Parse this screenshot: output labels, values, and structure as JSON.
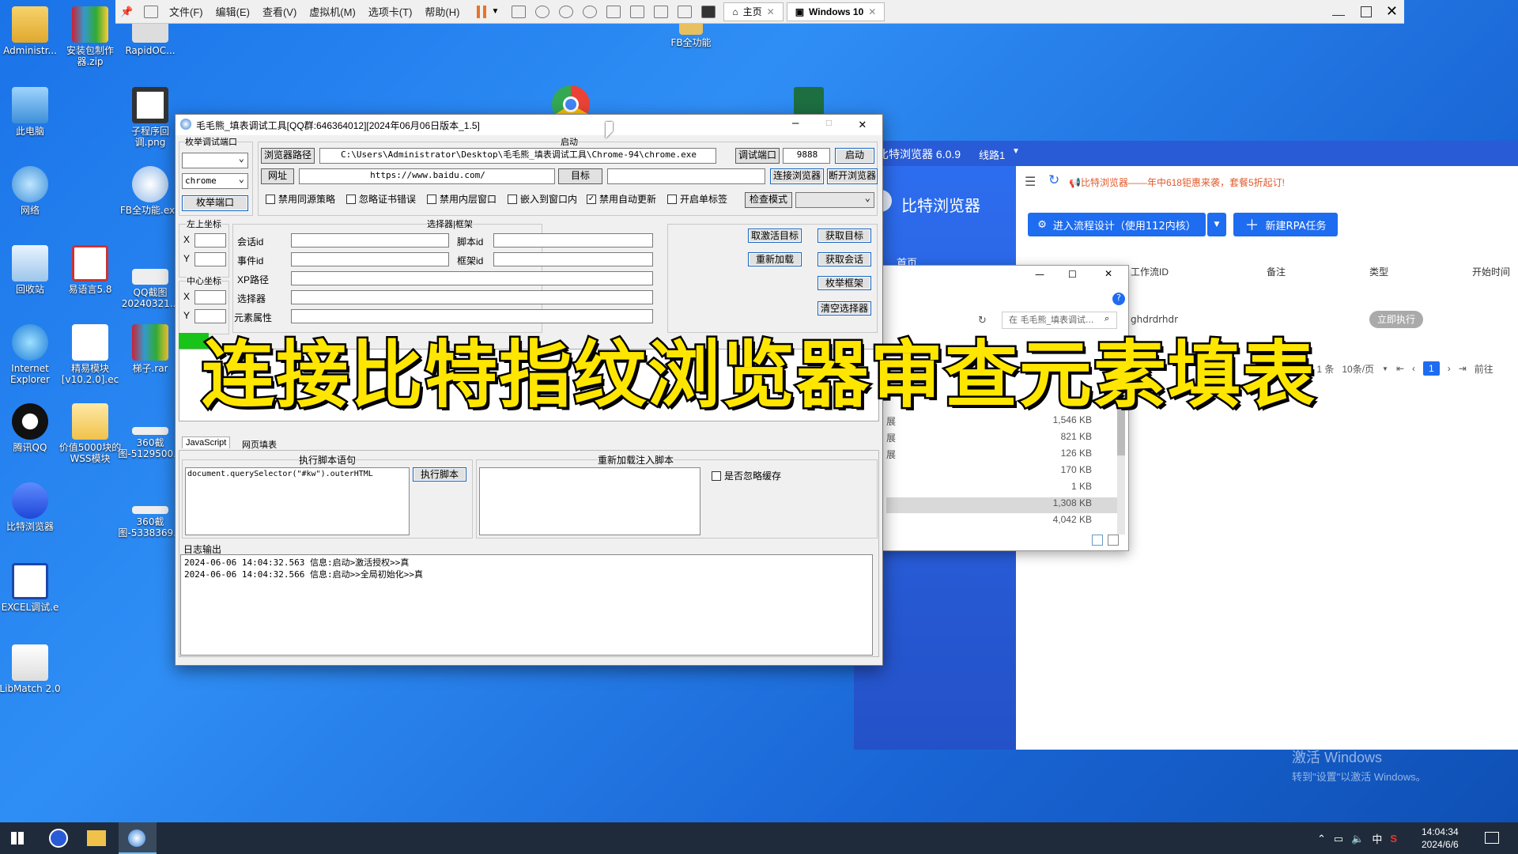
{
  "desktop": {
    "icons": [
      {
        "label": "Administr...",
        "name": "desktop-icon-admin"
      },
      {
        "label": "安装包制作器.zip",
        "name": "desktop-icon-installer-zip"
      },
      {
        "label": "RapidOC...",
        "name": "desktop-icon-rapidoc"
      },
      {
        "label": "此电脑",
        "name": "desktop-icon-this-pc"
      },
      {
        "label": "子程序回调.png",
        "name": "desktop-icon-subprogram-png"
      },
      {
        "label": "网络",
        "name": "desktop-icon-network"
      },
      {
        "label": "FB全功能.exe",
        "name": "desktop-icon-fb-exe"
      },
      {
        "label": "回收站",
        "name": "desktop-icon-recycle-bin"
      },
      {
        "label": "易语言5.8",
        "name": "desktop-icon-eyuyan"
      },
      {
        "label": "QQ截图20240321...",
        "name": "desktop-icon-qq-screenshot"
      },
      {
        "label": "Internet Explorer",
        "name": "desktop-icon-ie"
      },
      {
        "label": "精易模块[v10.2.0].ec",
        "name": "desktop-icon-jingyi"
      },
      {
        "label": "梯子.rar",
        "name": "desktop-icon-ladder-rar"
      },
      {
        "label": "腾讯QQ",
        "name": "desktop-icon-qq"
      },
      {
        "label": "价值5000块的WSS模块",
        "name": "desktop-icon-wss"
      },
      {
        "label": "360截图-5129500...",
        "name": "desktop-icon-360-1"
      },
      {
        "label": "比特浏览器",
        "name": "desktop-icon-bitbrowser"
      },
      {
        "label": "360截图-5338369...",
        "name": "desktop-icon-360-2"
      },
      {
        "label": "EXCEL调试.e",
        "name": "desktop-icon-excel-debug"
      },
      {
        "label": "LibMatch 2.0",
        "name": "desktop-icon-libmatch"
      },
      {
        "label": "FB全功能",
        "name": "desktop-icon-fb"
      }
    ],
    "activate_line1": "激活 Windows",
    "activate_line2": "转到\"设置\"以激活 Windows。"
  },
  "vm": {
    "menus": [
      "文件(F)",
      "编辑(E)",
      "查看(V)",
      "虚拟机(M)",
      "选项卡(T)",
      "帮助(H)"
    ],
    "tab_home": "主页",
    "tab_win": "Windows 10"
  },
  "tool": {
    "title": "毛毛熊_填表调试工具[QQ群:646364012][2024年06月06日版本_1.5]",
    "enum_port_group": "枚举调试端口",
    "chrome_select": "chrome",
    "enum_port_btn": "枚举端口",
    "launch_group": "启动",
    "browser_path_label": "浏览器路径",
    "browser_path": "C:\\Users\\Administrator\\Desktop\\毛毛熊_填表调试工具\\Chrome-94\\chrome.exe",
    "debug_port_label": "调试端口",
    "debug_port": "9888",
    "start_btn": "启动",
    "url_label": "网址",
    "url": "https://www.baidu.com/",
    "target_label": "目标",
    "connect_btn": "连接浏览器",
    "disconnect_btn": "断开浏览器",
    "checkboxes": [
      {
        "label": "禁用同源策略",
        "checked": false
      },
      {
        "label": "忽略证书错误",
        "checked": false
      },
      {
        "label": "禁用内层窗口",
        "checked": false
      },
      {
        "label": "嵌入到窗口内",
        "checked": false
      },
      {
        "label": "禁用自动更新",
        "checked": true
      },
      {
        "label": "开启单标签",
        "checked": false
      }
    ],
    "inspect_mode_btn": "检查模式",
    "topleft_group": "左上坐标",
    "center_group": "中心坐标",
    "x": "X",
    "y": "Y",
    "selector_group": "选择器|框架",
    "session_id": "会话id",
    "script_id": "脚本id",
    "event_id": "事件id",
    "frame_id": "框架id",
    "xpath": "XP路径",
    "selector": "选择器",
    "element_attr": "元素属性",
    "btn_cancel_target": "取激活目标",
    "btn_get_target": "获取目标",
    "btn_reload": "重新加载",
    "btn_get_session": "获取会话",
    "btn_enum_frames": "枚举框架",
    "btn_clear_selector": "清空选择器",
    "tab_js": "JavaScript",
    "tab_fill": "网页填表",
    "exec_group": "执行脚本语句",
    "exec_code": "document.querySelector(\"#kw\").outerHTML",
    "exec_btn": "执行脚本",
    "reload_group": "重新加载注入脚本",
    "ignore_cache": "是否忽略缓存",
    "log_group": "日志输出",
    "log_lines": [
      "2024-06-06 14:04:32.563 信息:启动>激活授权>>真",
      "2024-06-06 14:04:32.566 信息:启动>>全局初始化>>真"
    ]
  },
  "bit": {
    "title": "比特浏览器 6.0.9",
    "line": "线路1",
    "brand": "比特浏览器",
    "home": "首页",
    "promo": "比特浏览器——年中618钜惠来袭，套餐5折起订!",
    "design_btn": "进入流程设计（使用112内核）",
    "new_rpa_btn": "新建RPA任务",
    "cols": [
      "工作流ID",
      "备注",
      "类型",
      "开始时间"
    ],
    "row_id": "ghdrdrhdr",
    "run_btn": "立即执行",
    "total": "共 1 条",
    "per_page": "10条/页",
    "page": "1",
    "goto": "前往"
  },
  "explorer": {
    "search_placeholder": "在 毛毛熊_填表调试...",
    "rows": [
      {
        "kind": "展",
        "size": "1,546 KB"
      },
      {
        "kind": "展",
        "size": "821 KB"
      },
      {
        "kind": "展",
        "size": "126 KB"
      },
      {
        "kind": "",
        "size": "170 KB"
      },
      {
        "kind": "",
        "size": "1 KB"
      },
      {
        "kind": "",
        "size": "1,308 KB"
      },
      {
        "kind": "",
        "size": "4,042 KB"
      }
    ]
  },
  "caption": "连接比特指纹浏览器审查元素填表",
  "taskbar": {
    "time": "14:04:34",
    "date": "2024/6/6",
    "ime": "中"
  }
}
